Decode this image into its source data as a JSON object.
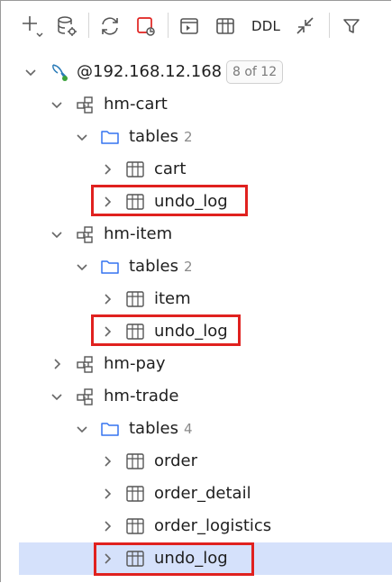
{
  "toolbar": {
    "ddl_label": "DDL"
  },
  "tree": {
    "host": {
      "label": "@192.168.12.168",
      "badge": "8 of 12"
    },
    "hm_cart": {
      "label": "hm-cart",
      "tables": {
        "label": "tables",
        "count": "2"
      },
      "items": [
        "cart",
        "undo_log"
      ]
    },
    "hm_item": {
      "label": "hm-item",
      "tables": {
        "label": "tables",
        "count": "2"
      },
      "items": [
        "item",
        "undo_log"
      ]
    },
    "hm_pay": {
      "label": "hm-pay"
    },
    "hm_trade": {
      "label": "hm-trade",
      "tables": {
        "label": "tables",
        "count": "4"
      },
      "items": [
        "order",
        "order_detail",
        "order_logistics",
        "undo_log"
      ]
    }
  },
  "colors": {
    "highlight": "#e0211f",
    "folder": "#3574f0",
    "selection": "#d5e1fb"
  }
}
